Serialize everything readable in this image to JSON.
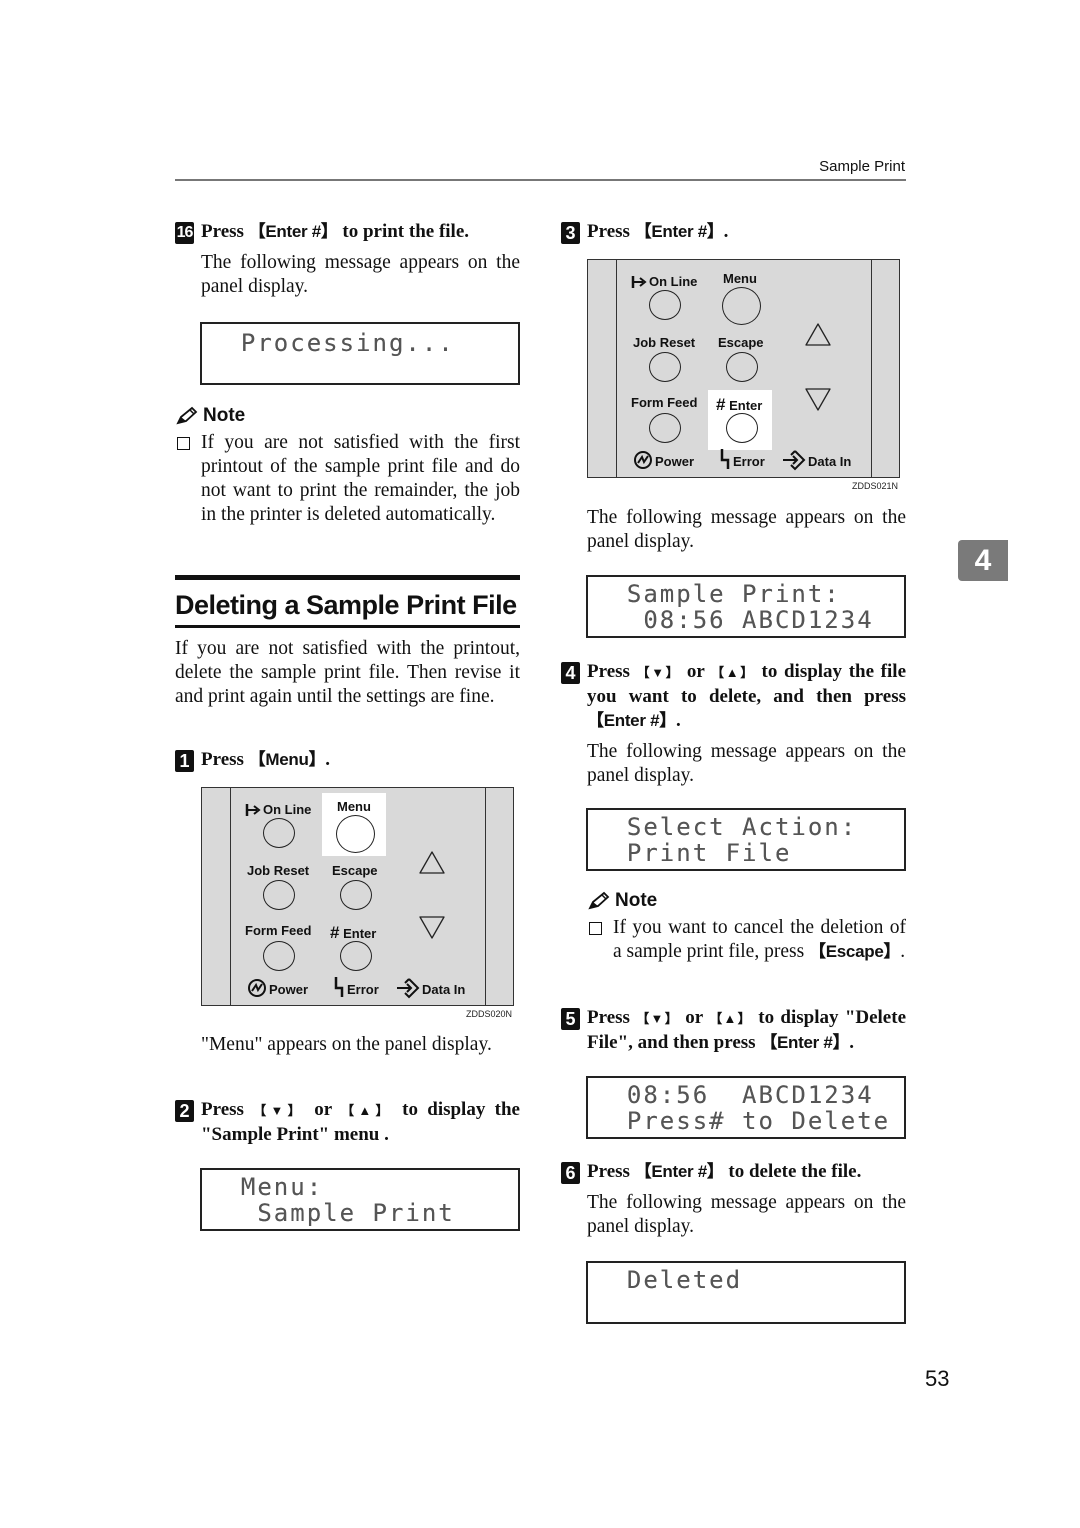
{
  "header": {
    "running_head": "Sample Print"
  },
  "chapter_tab": "4",
  "page_number": "53",
  "left": {
    "step16": {
      "number": "16",
      "prefix": "Press ",
      "key": "Enter #",
      "suffix": " to print the file.",
      "body": "The following message appears on the panel display.",
      "lcd": [
        "  Processing..."
      ]
    },
    "note1": {
      "title": "Note",
      "text": "If you are not satisfied with the first printout of the sample print file and do not want to print the remainder, the job in the printer is deleted automatically."
    },
    "section": {
      "title": "Deleting a Sample Print File",
      "intro": "If you are not satisfied with the printout, delete the sample print file. Then revise it and print again until the settings are fine."
    },
    "step1": {
      "number": "1",
      "prefix": "Press ",
      "key": "Menu",
      "suffix": "."
    },
    "panel1": {
      "code": "ZDDS020N",
      "highlight": "Menu"
    },
    "step1_body": "\"Menu\" appears on the panel display.",
    "step2": {
      "number": "2",
      "prefix": "Press ",
      "key_down": "▼",
      "mid": " or ",
      "key_up": "▲",
      "suffix": " to display the \"Sample Print\" menu .",
      "lcd": [
        "  Menu:",
        "   Sample Print"
      ]
    }
  },
  "right": {
    "step3": {
      "number": "3",
      "prefix": "Press ",
      "key": "Enter #",
      "suffix": "."
    },
    "panel2": {
      "code": "ZDDS021N",
      "highlight": "Enter"
    },
    "step3_body": "The following message appears on the panel display.",
    "step3_lcd": [
      "  Sample Print:",
      "   08:56 ABCD1234"
    ],
    "step4": {
      "number": "4",
      "prefix": "Press ",
      "key_down": "▼",
      "mid": " or ",
      "key_up": "▲",
      "suffix": " to display the file you want to delete, and then press ",
      "key": "Enter #",
      "end": ".",
      "body": "The following message appears on the panel display.",
      "lcd": [
        "  Select Action:",
        "  Print File"
      ]
    },
    "note2": {
      "title": "Note",
      "text": "If you want to cancel the deletion of a sample print file, press ",
      "key": "Escape",
      "end": "."
    },
    "step5": {
      "number": "5",
      "prefix": "Press ",
      "key_down": "▼",
      "mid": " or ",
      "key_up": "▲",
      "suffix": " to display \"Delete File\", and then press ",
      "key": "Enter #",
      "end": ".",
      "lcd": [
        "  08:56  ABCD1234",
        "  Press# to Delete"
      ]
    },
    "step6": {
      "number": "6",
      "prefix": "Press ",
      "key": "Enter #",
      "suffix": " to delete the file.",
      "body": "The following message appears on the panel display.",
      "lcd": [
        "  Deleted"
      ]
    }
  },
  "panel_labels": {
    "online": "On Line",
    "menu": "Menu",
    "job_reset": "Job Reset",
    "escape": "Escape",
    "form_feed": "Form Feed",
    "enter": "Enter",
    "power": "Power",
    "error": "Error",
    "data_in": "Data In"
  }
}
